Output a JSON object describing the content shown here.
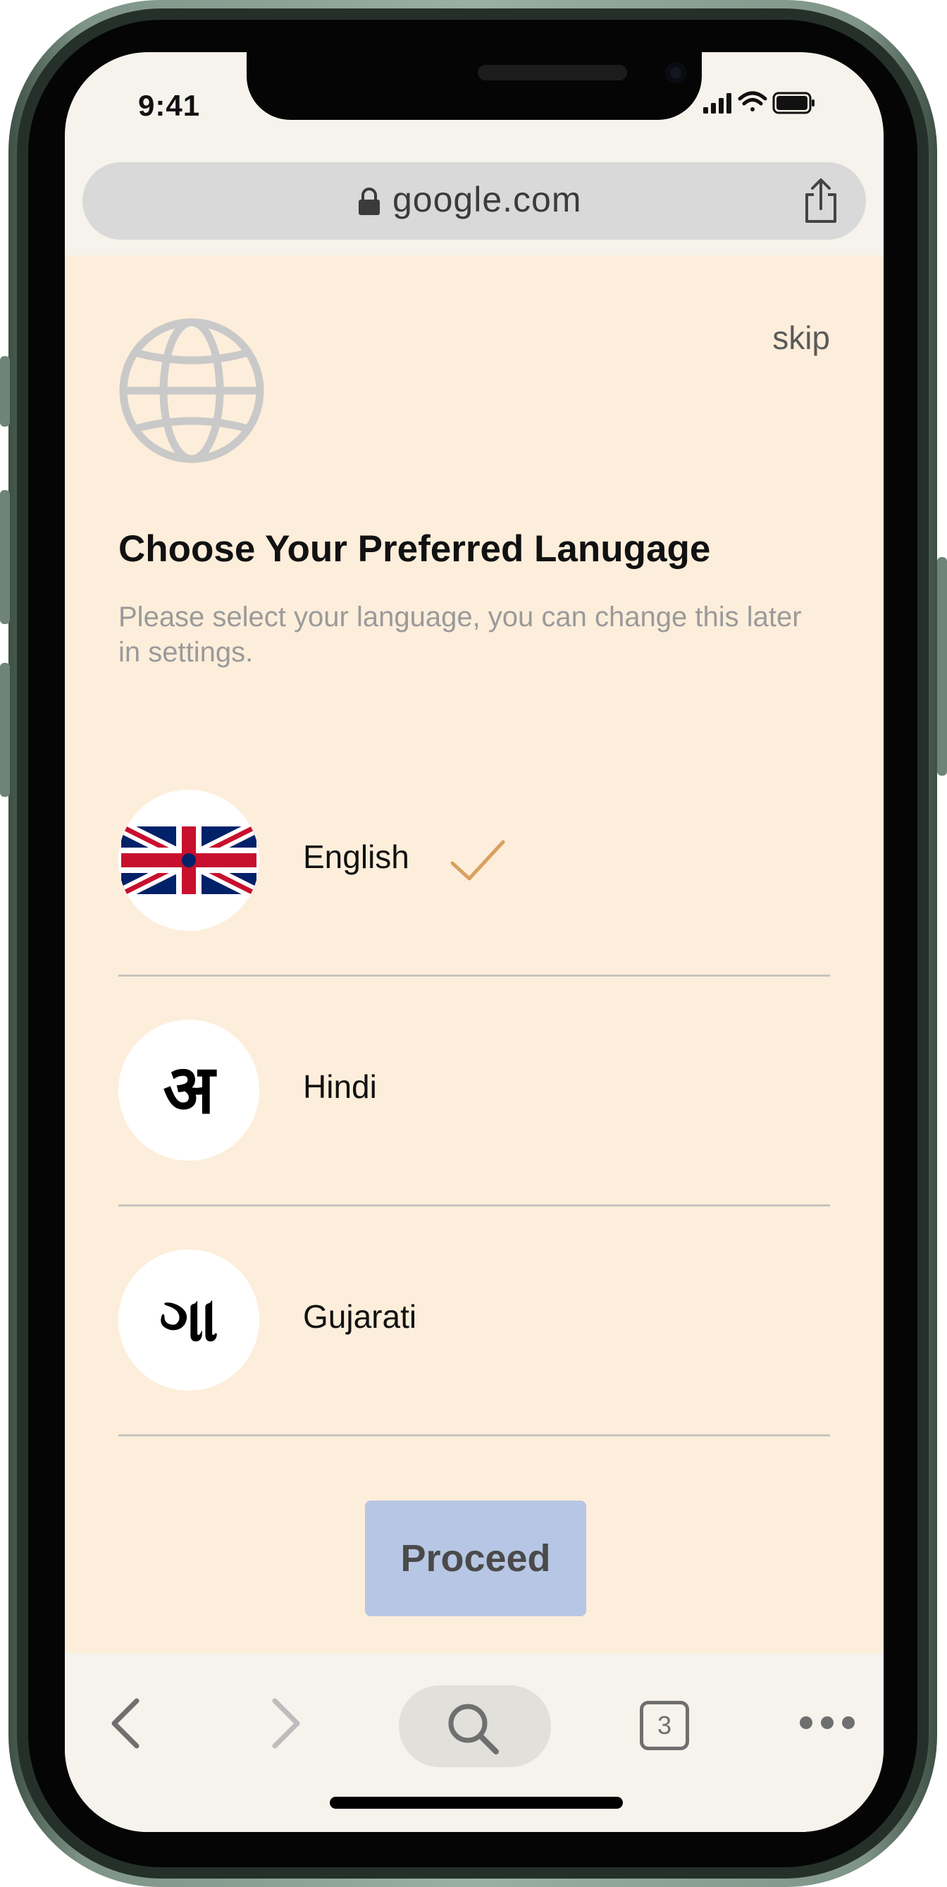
{
  "status_bar": {
    "time": "9:41"
  },
  "browser": {
    "url": "google.com"
  },
  "screen": {
    "skip_label": "skip",
    "title": "Choose Your Preferred Lanugage",
    "subtitle": "Please select your language, you can change this later in settings.",
    "languages": [
      {
        "name": "English",
        "icon": "uk-flag-icon",
        "selected": true
      },
      {
        "name": "Hindi",
        "icon_glyph": "अ",
        "selected": false
      },
      {
        "name": "Gujarati",
        "icon_glyph": "ગા",
        "selected": false
      }
    ],
    "proceed_label": "Proceed"
  },
  "toolbar": {
    "tab_count": "3"
  },
  "colors": {
    "background": "#fdeedb",
    "accent_check": "#d9a060",
    "button": "#b7c6e4",
    "globe": "#c9c9c9"
  }
}
